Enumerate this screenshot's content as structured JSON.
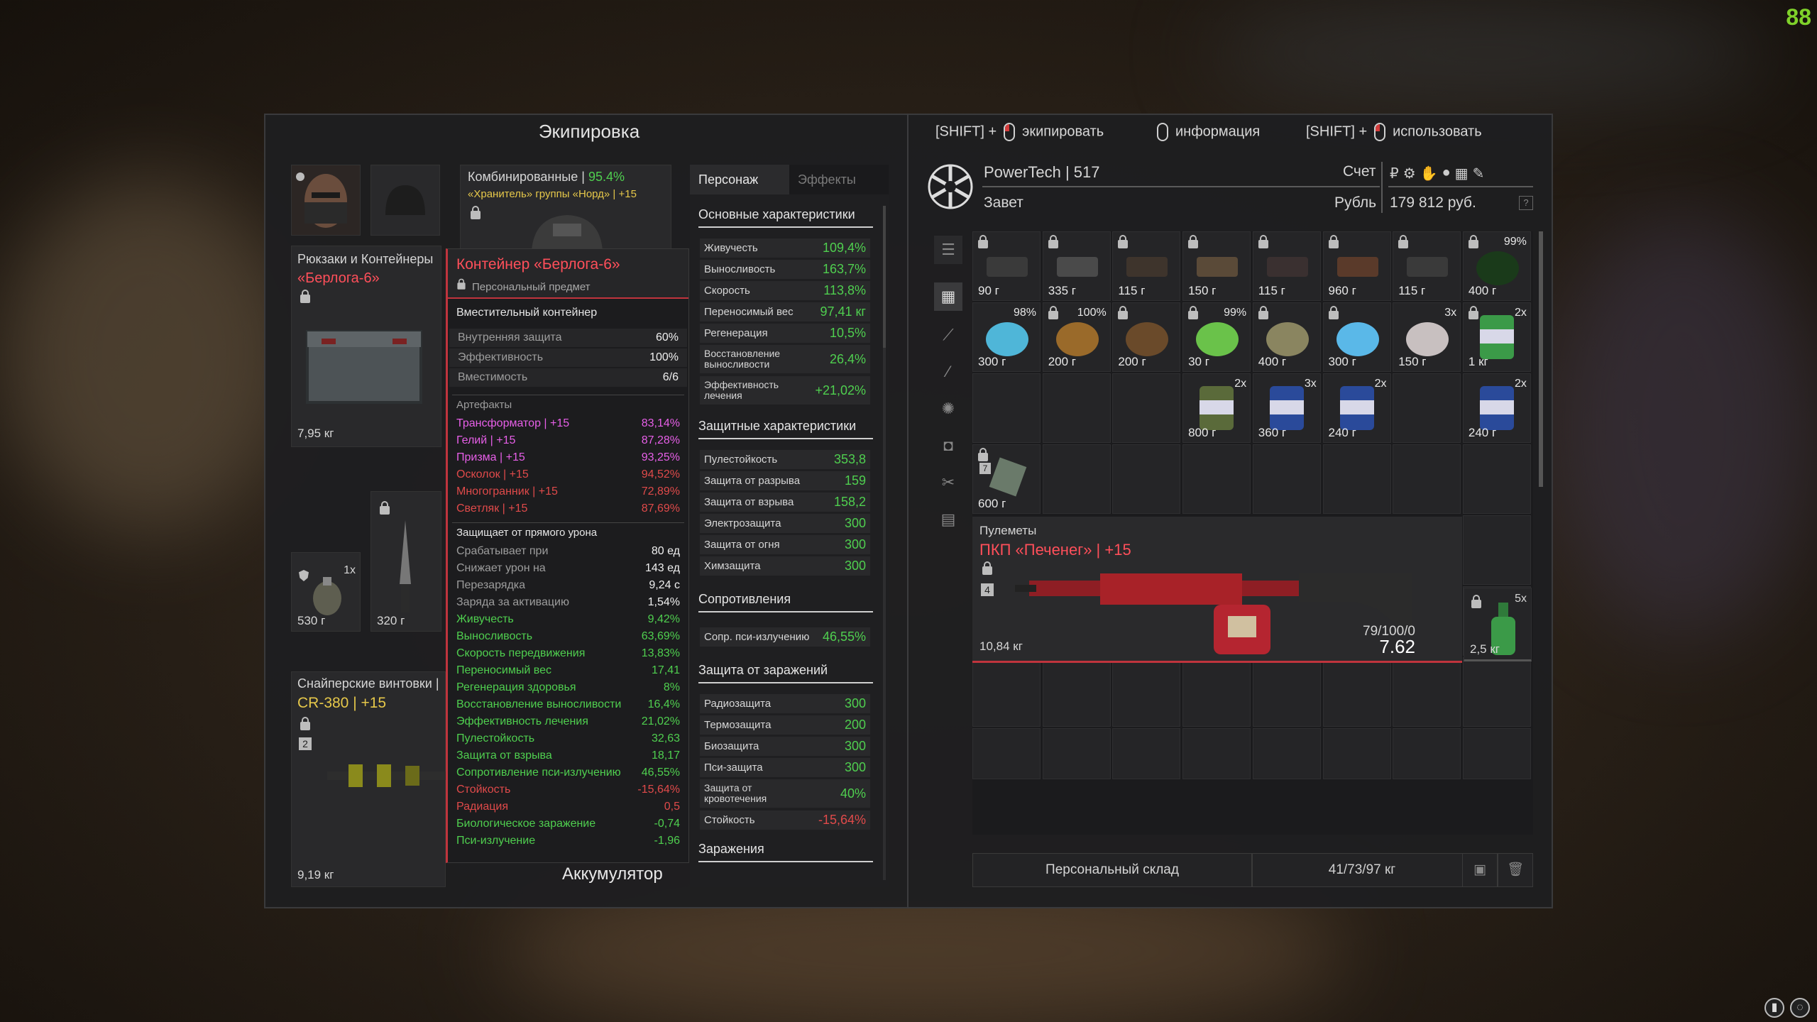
{
  "fps": "88",
  "equipment": {
    "title": "Экипировка",
    "combined_label": "Комбинированные | ",
    "combined_pct": "95.4%",
    "combined_item": "«Хранитель» группы «Норд» | +15",
    "backpacks_label": "Рюкзаки и Контейнеры",
    "backpack_name": "«Берлога-6»",
    "backpack_weight": "7,95 кг",
    "grenade_qty": "1x",
    "grenade_weight": "530 г",
    "knife_weight": "320 г",
    "snipers_label": "Снайперские винтовки | ",
    "sniper_name": "CR-380 | +15",
    "sniper_slot_num": "2",
    "sniper_weight": "9,19 кг",
    "accumulator": "Аккумулятор"
  },
  "hints": {
    "shift1": "[SHIFT] +",
    "equip": "экипировать",
    "info": "информация",
    "shift2": "[SHIFT] +",
    "use": "использовать"
  },
  "tooltip": {
    "name": "Контейнер «Берлога-6»",
    "personal": "Персональный предмет",
    "type": "Вместительный контейнер",
    "props": [
      {
        "label": "Внутренняя защита",
        "value": "60%"
      },
      {
        "label": "Эффективность",
        "value": "100%"
      },
      {
        "label": "Вместимость",
        "value": "6/6"
      }
    ],
    "artifacts_title": "Артефакты",
    "artifacts": [
      {
        "label": "Трансформатор | +15",
        "value": "83,14%",
        "color": "pink"
      },
      {
        "label": "Гелий | +15",
        "value": "87,28%",
        "color": "pink"
      },
      {
        "label": "Призма | +15",
        "value": "93,25%",
        "color": "pink"
      },
      {
        "label": "Осколок | +15",
        "value": "94,52%",
        "color": "red"
      },
      {
        "label": "Многогранник | +15",
        "value": "72,89%",
        "color": "red"
      },
      {
        "label": "Светляк | +15",
        "value": "87,69%",
        "color": "red"
      }
    ],
    "protects_title": "Защищает от прямого урона",
    "protects": [
      {
        "label": "Срабатывает при",
        "value": "80 ед",
        "color": "gray"
      },
      {
        "label": "Снижает урон на",
        "value": "143 ед",
        "color": "gray"
      },
      {
        "label": "Перезарядка",
        "value": "9,24 с",
        "color": "gray"
      },
      {
        "label": "Заряда за активацию",
        "value": "1,54%",
        "color": "gray"
      }
    ],
    "bonuses": [
      {
        "label": "Живучесть",
        "value": "9,42%",
        "color": "green"
      },
      {
        "label": "Выносливость",
        "value": "63,69%",
        "color": "green"
      },
      {
        "label": "Скорость передвижения",
        "value": "13,83%",
        "color": "green"
      },
      {
        "label": "Переносимый вес",
        "value": "17,41",
        "color": "green"
      },
      {
        "label": "Регенерация здоровья",
        "value": "8%",
        "color": "green"
      },
      {
        "label": "Восстановление выносливости",
        "value": "16,4%",
        "color": "green"
      },
      {
        "label": "Эффективность лечения",
        "value": "21,02%",
        "color": "green"
      },
      {
        "label": "Пулестойкость",
        "value": "32,63",
        "color": "green"
      },
      {
        "label": "Защита от взрыва",
        "value": "18,17",
        "color": "green"
      },
      {
        "label": "Сопротивление пси-излучению",
        "value": "46,55%",
        "color": "green"
      },
      {
        "label": "Стойкость",
        "value": "-15,64%",
        "color": "red"
      },
      {
        "label": "Радиация",
        "value": "0,5",
        "color": "red"
      },
      {
        "label": "Биологическое заражение",
        "value": "-0,74",
        "color": "green"
      },
      {
        "label": "Пси-излучение",
        "value": "-1,96",
        "color": "green"
      }
    ]
  },
  "stats": {
    "tab_character": "Персонаж",
    "tab_effects": "Эффекты",
    "main_title": "Основные характеристики",
    "main": [
      {
        "label": "Живучесть",
        "value": "109,4%"
      },
      {
        "label": "Выносливость",
        "value": "163,7%"
      },
      {
        "label": "Скорость",
        "value": "113,8%"
      },
      {
        "label": "Переносимый вес",
        "value": "97,41 кг"
      },
      {
        "label": "Регенерация",
        "value": "10,5%"
      },
      {
        "label": "Восстановление выносливости",
        "value": "26,4%"
      },
      {
        "label": "Эффективность лечения",
        "value": "+21,02%"
      }
    ],
    "protect_title": "Защитные характеристики",
    "protect": [
      {
        "label": "Пулестойкость",
        "value": "353,8"
      },
      {
        "label": "Защита от разрыва",
        "value": "159"
      },
      {
        "label": "Защита от взрыва",
        "value": "158,2"
      },
      {
        "label": "Электрозащита",
        "value": "300"
      },
      {
        "label": "Защита от огня",
        "value": "300"
      },
      {
        "label": "Химзащита",
        "value": "300"
      }
    ],
    "resist_title": "Сопротивления",
    "resist": [
      {
        "label": "Сопр. пси-излучению",
        "value": "46,55%"
      }
    ],
    "infect_title": "Защита от заражений",
    "infect": [
      {
        "label": "Радиозащита",
        "value": "300"
      },
      {
        "label": "Термозащита",
        "value": "200"
      },
      {
        "label": "Биозащита",
        "value": "300"
      },
      {
        "label": "Пси-защита",
        "value": "300"
      },
      {
        "label": "Защита от кровотечения",
        "value": "40%"
      },
      {
        "label": "Стойкость",
        "value": "-15,64%",
        "neg": true
      }
    ],
    "contam_title": "Заражения"
  },
  "storage": {
    "owner": "PowerTech | 517",
    "faction": "Завет",
    "account_label": "Счет",
    "currency_label": "Рубль",
    "money": "179 812 руб.",
    "items_row1": [
      {
        "w": "90 г"
      },
      {
        "w": "335 г"
      },
      {
        "w": "115 г"
      },
      {
        "w": "150 г"
      },
      {
        "w": "115 г"
      },
      {
        "w": "960 г"
      },
      {
        "w": "115 г"
      },
      {
        "w": "400 г",
        "q": "99%"
      }
    ],
    "items_row2": [
      {
        "w": "300 г",
        "q": "98%"
      },
      {
        "w": "200 г",
        "q": "100%"
      },
      {
        "w": "200 г"
      },
      {
        "w": "30 г",
        "q": "99%"
      },
      {
        "w": "400 г"
      },
      {
        "w": "300 г"
      },
      {
        "w": "150 г",
        "q": "3x"
      },
      {
        "w": "1 кг",
        "q": "2x"
      }
    ],
    "items_row3": [
      {
        "w": "800 г",
        "q": "2x"
      },
      {
        "w": "360 г",
        "q": "3x"
      },
      {
        "w": "240 г",
        "q": "2x"
      },
      {
        "w": "240 г",
        "q": "2x"
      }
    ],
    "item_row4_w": "600 г",
    "item_row4_num": "7",
    "weapon_cat": "Пулеметы",
    "weapon_name": "ПКП «Печенег» | +15",
    "weapon_slot": "4",
    "weapon_weight": "10,84 кг",
    "weapon_ammo": "79/100/0",
    "weapon_caliber": "7.62",
    "bottle_qty": "5x",
    "bottle_w": "2,5 кг",
    "footer_label": "Персональный склад",
    "footer_weight": "41/73/97 кг"
  },
  "colors": {
    "accent_red": "#c0343d",
    "green": "#4fcf4f",
    "pink": "#e75fe8",
    "yellow": "#e6c84a"
  }
}
